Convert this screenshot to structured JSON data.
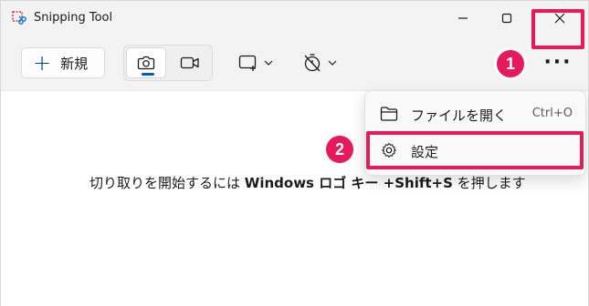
{
  "window": {
    "title": "Snipping Tool",
    "app_icon": "snipping-tool-icon"
  },
  "window_controls": {
    "minimize_icon": "minimize-icon",
    "maximize_icon": "maximize-icon",
    "close_icon": "close-icon"
  },
  "toolbar": {
    "new_label": "新規",
    "new_icon": "plus-icon",
    "modes": [
      {
        "name": "screenshot",
        "icon": "camera-icon",
        "selected": true
      },
      {
        "name": "video",
        "icon": "video-camera-icon",
        "selected": false
      }
    ],
    "snip_shape_icon": "rectangle-snip-icon",
    "delay_icon": "timer-off-icon",
    "more_label": "···"
  },
  "menu": {
    "items": [
      {
        "label": "ファイルを開く",
        "shortcut": "Ctrl+O",
        "icon": "folder-icon"
      },
      {
        "label": "設定",
        "shortcut": "",
        "icon": "gear-icon"
      }
    ]
  },
  "hint": {
    "prefix": "切り取りを開始するには ",
    "key": "Windows ロゴ キー +Shift+S",
    "suffix": " を押します"
  },
  "annotations": {
    "step1": "1",
    "step2": "2",
    "highlight_color": "#e6195a"
  },
  "colors": {
    "accent": "#005fb8",
    "annotation": "#e6195a"
  }
}
